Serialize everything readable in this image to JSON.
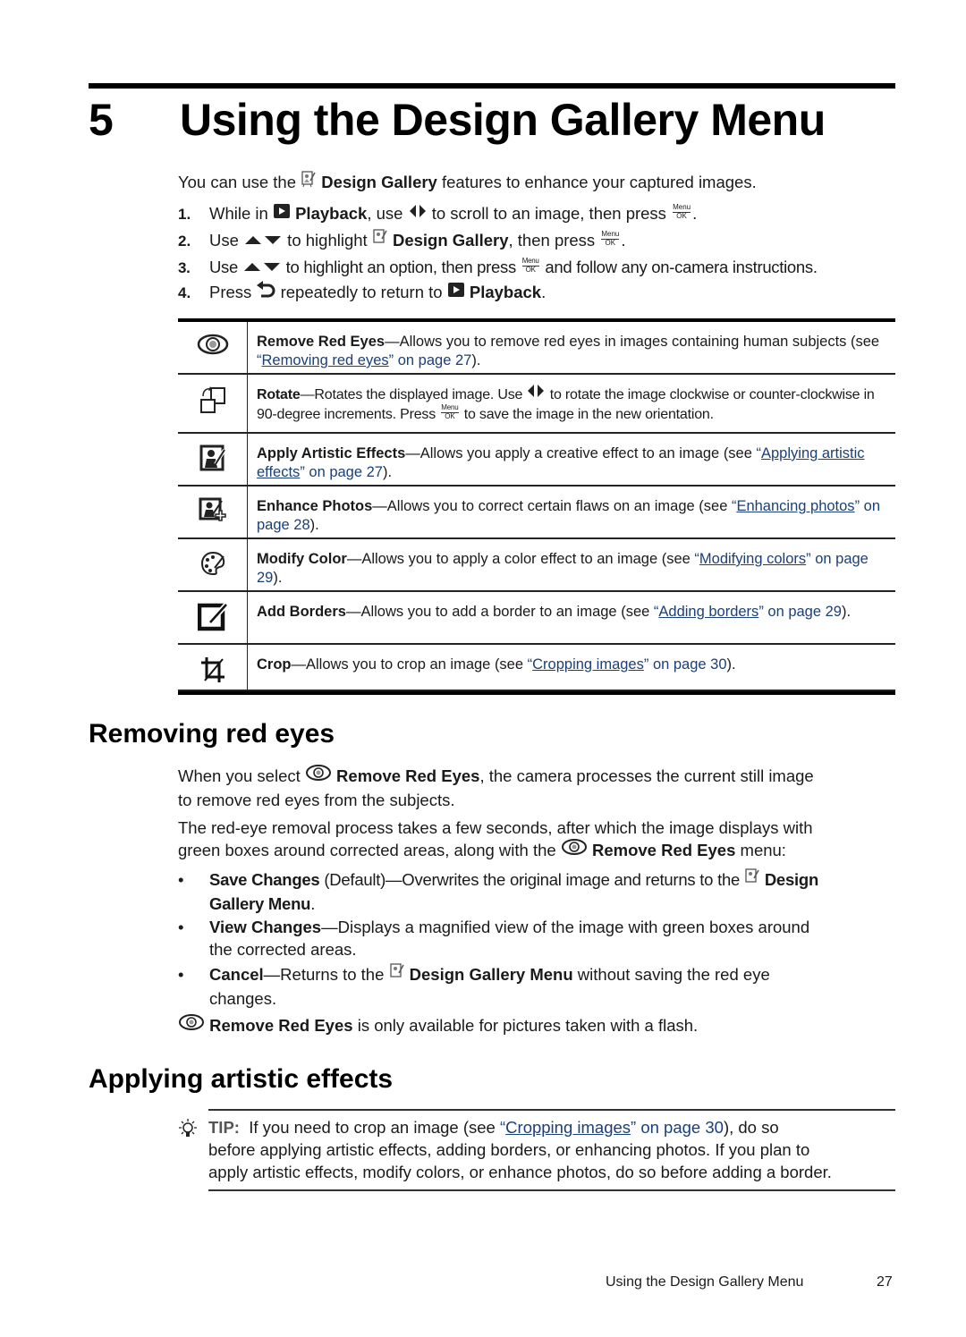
{
  "chapter": {
    "number": "5",
    "title": "Using the Design Gallery Menu"
  },
  "intro": {
    "before": "You can use the ",
    "bold": "Design Gallery",
    "after": " features to enhance your captured images."
  },
  "steps": [
    {
      "n": "1.",
      "t1": "While in ",
      "b1": "Playback",
      "t2": ", use ",
      "t3": " to scroll to an image, then press ",
      "t4": "."
    },
    {
      "n": "2.",
      "t1": "Use ",
      "t2": " to highlight ",
      "b1": "Design Gallery",
      "t3": ", then press ",
      "t4": "."
    },
    {
      "n": "3.",
      "t1": "Use ",
      "t2": " to highlight an option, then press ",
      "t3": " and follow any on-camera instructions."
    },
    {
      "n": "4.",
      "t1": "Press ",
      "t2": " repeatedly to return to ",
      "b1": "Playback",
      "t3": "."
    }
  ],
  "menu_ok": {
    "top": "Menu",
    "bottom": "OK"
  },
  "table": [
    {
      "icon": "red-eye-icon",
      "title": "Remove Red Eyes",
      "text": "—Allows you to remove red eyes in images containing human subjects (see ",
      "link": "Removing red eyes",
      "page": " on page 27",
      "end": ")."
    },
    {
      "icon": "rotate-icon",
      "title": "Rotate",
      "text1": "—Rotates the displayed image. Use ",
      "text2": " to rotate the image clockwise or counter-clockwise in 90-degree increments. Press ",
      "text3": " to save the image in the new orientation."
    },
    {
      "icon": "artistic-effects-icon",
      "title": "Apply Artistic Effects",
      "text": "—Allows you apply a creative effect to an image (see ",
      "link": "Applying artistic effects",
      "page": " on page 27",
      "end": ")."
    },
    {
      "icon": "enhance-photos-icon",
      "title": "Enhance Photos",
      "text": "—Allows you to correct certain flaws on an image (see ",
      "link": "Enhancing photos",
      "page": " on page 28",
      "end": ")."
    },
    {
      "icon": "palette-icon",
      "title": "Modify Color",
      "text": "—Allows you to apply a color effect to an image (see ",
      "link": "Modifying colors",
      "page": " on page 29",
      "end": ")."
    },
    {
      "icon": "border-icon",
      "title": "Add Borders",
      "text": "—Allows you to add a border to an image (see ",
      "link": "Adding borders",
      "page": " on page 29",
      "end": ")."
    },
    {
      "icon": "crop-icon",
      "title": "Crop",
      "text": "—Allows you to crop an image (see ",
      "link": "Cropping images",
      "page": " on page 30",
      "end": ")."
    }
  ],
  "section1": {
    "title": "Removing red eyes",
    "p1a": "When you select ",
    "p1b": "Remove Red Eyes",
    "p1c": ", the camera processes the current still image",
    "p1d": "to remove red eyes from the subjects.",
    "p2a": "The red-eye removal process takes a few seconds, after which the image displays with",
    "p2b": "green boxes around corrected areas, along with the ",
    "p2c": "Remove Red Eyes",
    "p2d": " menu:",
    "bullets": [
      {
        "b": "Save Changes",
        "t": " (Default)—Overwrites the original image and returns to the ",
        "b2": "Design",
        "l2": "Gallery Menu",
        "l2end": "."
      },
      {
        "b": "View Changes",
        "t": "—Displays a magnified view of the image with green boxes around",
        "l2": "the corrected areas."
      },
      {
        "b": "Cancel",
        "t": "—Returns to the ",
        "b2": "Design Gallery Menu",
        "t2": " without saving the red eye",
        "l2": "changes."
      }
    ],
    "note_b": "Remove Red Eyes",
    "note_t": " is only available for pictures taken with a flash."
  },
  "section2": {
    "title": "Applying artistic effects",
    "tip_label": "TIP:",
    "tip1": "  If you need to crop an image (see ",
    "tip_link": "Cropping images",
    "tip_page": " on page 30",
    "tip_end": "), do so",
    "tip2": "before applying artistic effects, adding borders, or enhancing photos. If you plan to",
    "tip3": "apply artistic effects, modify colors, or enhance photos, do so before adding a border."
  },
  "footer": {
    "title": "Using the Design Gallery Menu",
    "page": "27"
  },
  "colors": {
    "link": "#1b3f78",
    "text": "#1a1a1a"
  }
}
